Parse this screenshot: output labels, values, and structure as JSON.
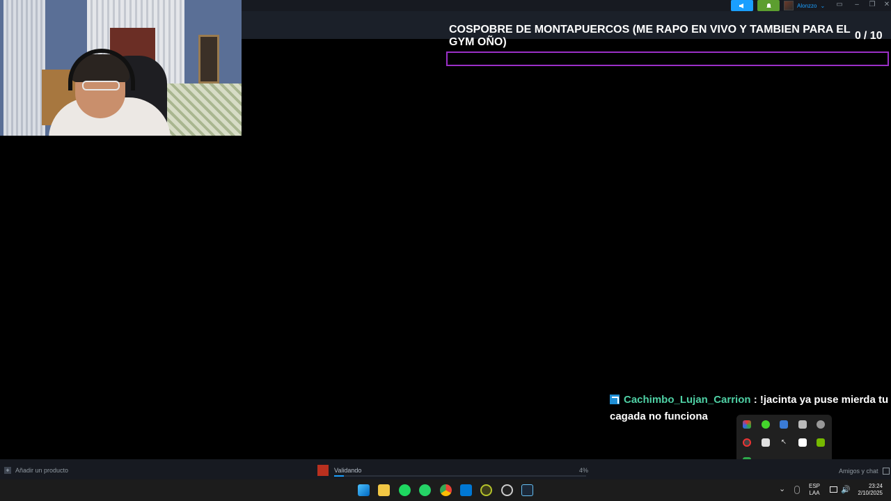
{
  "topbar": {
    "username": "Alonzzo",
    "accent": "#1a9fff",
    "icons": [
      "megaphone-icon",
      "bell-icon",
      "monitor-icon",
      "minimize-icon",
      "restore-icon",
      "close-icon"
    ]
  },
  "prediction": {
    "title": "COSPOBRE DE MONTAPUERCOS (ME RAPO EN VIVO Y TAMBIEN PARA EL GYM OÑO)",
    "count": "0",
    "total": "/ 10",
    "border_color": "#9b30c8"
  },
  "chat": {
    "username": "Cachimbo_Lujan_Carrion",
    "separator": " : ",
    "message": "!jacinta ya puse mierda tu cagada no funciona",
    "username_color": "#4fd1a5"
  },
  "bottombar": {
    "add_product": "Añadir un producto",
    "download_status": "Validando",
    "download_percent": "4%",
    "download_progress": 0.04,
    "friends_chat": "Amigos y chat"
  },
  "tray_popup": {
    "icons": [
      "colorful-app-icon",
      "razer-icon",
      "bluetooth-icon",
      "device-icon",
      "settings-icon",
      "shutter-icon",
      "discord-icon",
      "cursor-icon",
      "x-app-icon",
      "nvidia-icon",
      "green-app-icon"
    ]
  },
  "taskbar": {
    "apps": [
      "windows-start-icon",
      "file-explorer-icon",
      "spotify-icon",
      "whatsapp-icon",
      "chrome-icon",
      "photos-icon",
      "razer-cortex-icon",
      "obs-icon",
      "steam-icon"
    ],
    "language_line1": "ESP",
    "language_line2": "LAA",
    "time": "23:24",
    "date": "2/10/2025"
  }
}
